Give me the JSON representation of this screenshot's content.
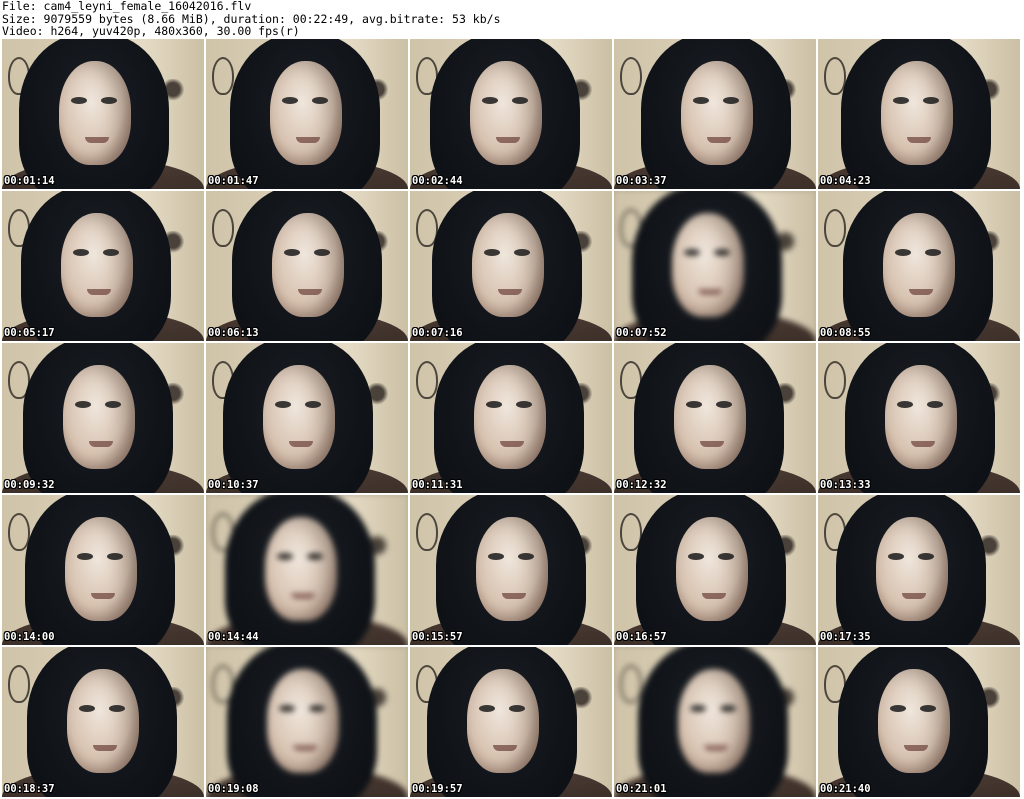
{
  "header": {
    "file_line": "File: cam4_leyni_female_16042016.flv",
    "size_line": "Size: 9079559 bytes (8.66 MiB), duration: 00:22:49, avg.bitrate: 53 kb/s",
    "video_line": "Video: h264, yuv420p, 480x360, 30.00 fps(r)"
  },
  "thumbnails": [
    {
      "timestamp": "00:01:14"
    },
    {
      "timestamp": "00:01:47"
    },
    {
      "timestamp": "00:02:44"
    },
    {
      "timestamp": "00:03:37"
    },
    {
      "timestamp": "00:04:23"
    },
    {
      "timestamp": "00:05:17"
    },
    {
      "timestamp": "00:06:13"
    },
    {
      "timestamp": "00:07:16"
    },
    {
      "timestamp": "00:07:52"
    },
    {
      "timestamp": "00:08:55"
    },
    {
      "timestamp": "00:09:32"
    },
    {
      "timestamp": "00:10:37"
    },
    {
      "timestamp": "00:11:31"
    },
    {
      "timestamp": "00:12:32"
    },
    {
      "timestamp": "00:13:33"
    },
    {
      "timestamp": "00:14:00"
    },
    {
      "timestamp": "00:14:44"
    },
    {
      "timestamp": "00:15:57"
    },
    {
      "timestamp": "00:16:57"
    },
    {
      "timestamp": "00:17:35"
    },
    {
      "timestamp": "00:18:37"
    },
    {
      "timestamp": "00:19:08"
    },
    {
      "timestamp": "00:19:57"
    },
    {
      "timestamp": "00:21:01"
    },
    {
      "timestamp": "00:21:40"
    }
  ]
}
